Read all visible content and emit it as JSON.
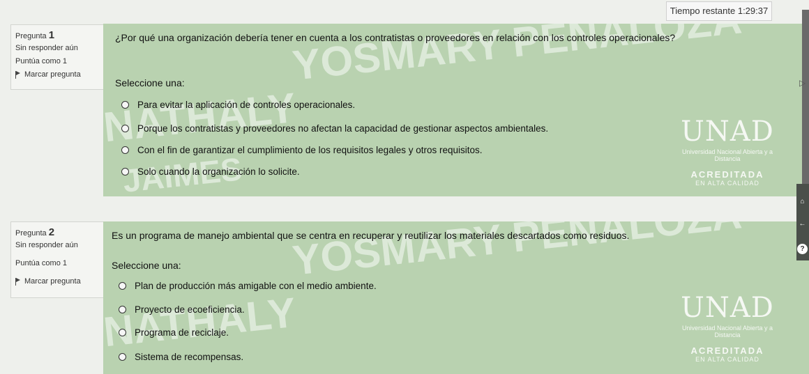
{
  "timer": {
    "label": "Tiempo restante",
    "value": "1:29:37"
  },
  "questions": [
    {
      "prefix": "Pregunta",
      "number": "1",
      "status": "Sin responder aún",
      "score": "Puntúa como 1",
      "flag": "Marcar pregunta",
      "text": "¿Por qué una organización debería tener en cuenta a los contratistas o proveedores en relación con los controles operacionales?",
      "prompt": "Seleccione una:",
      "options": [
        "Para evitar la aplicación de controles operacionales.",
        "Porque los contratistas y proveedores no afectan la capacidad de gestionar aspectos ambientales.",
        "Con el fin de garantizar el cumplimiento de los requisitos legales y otros requisitos.",
        "Solo cuando la organización lo solicite."
      ]
    },
    {
      "prefix": "Pregunta",
      "number": "2",
      "status": "Sin responder aún",
      "score": "Puntúa como 1",
      "flag": "Marcar pregunta",
      "text": "Es un programa de manejo ambiental que se centra en recuperar y reutilizar los materiales descartados como residuos.",
      "prompt": "Seleccione una:",
      "options": [
        "Plan de producción más amigable con el medio ambiente.",
        "Proyecto de ecoeficiencia.",
        "Programa de reciclaje.",
        "Sistema de recompensas."
      ]
    }
  ],
  "watermark": {
    "line1": "YOSMARY PEÑALOZA",
    "line2": "NATHALY",
    "line3": "JAIMES"
  },
  "logo": {
    "mark": "UNAD",
    "line1": "Universidad Nacional Abierta y a Distancia",
    "line2": "ACREDITADA",
    "line3": "EN ALTA CALIDAD"
  },
  "icons": [
    "home-icon",
    "back-arrow-icon",
    "help-icon"
  ]
}
